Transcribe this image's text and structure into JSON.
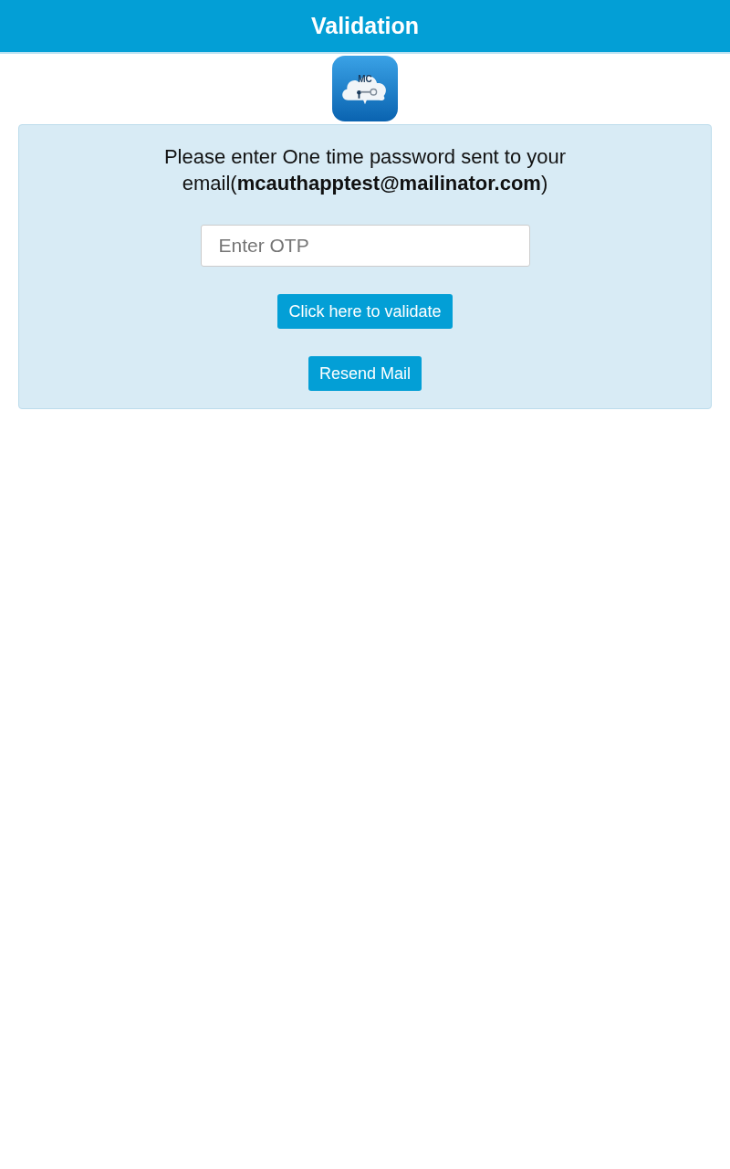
{
  "header": {
    "title": "Validation"
  },
  "logo": {
    "text": "MC"
  },
  "panel": {
    "message": "Please enter One time password sent to your email(**mcauthapptest@mailinator.com**)",
    "otp_field": {
      "placeholder": "Enter OTP"
    },
    "buttons": [
      "Click here to validate",
      "Resend Mail"
    ]
  }
}
